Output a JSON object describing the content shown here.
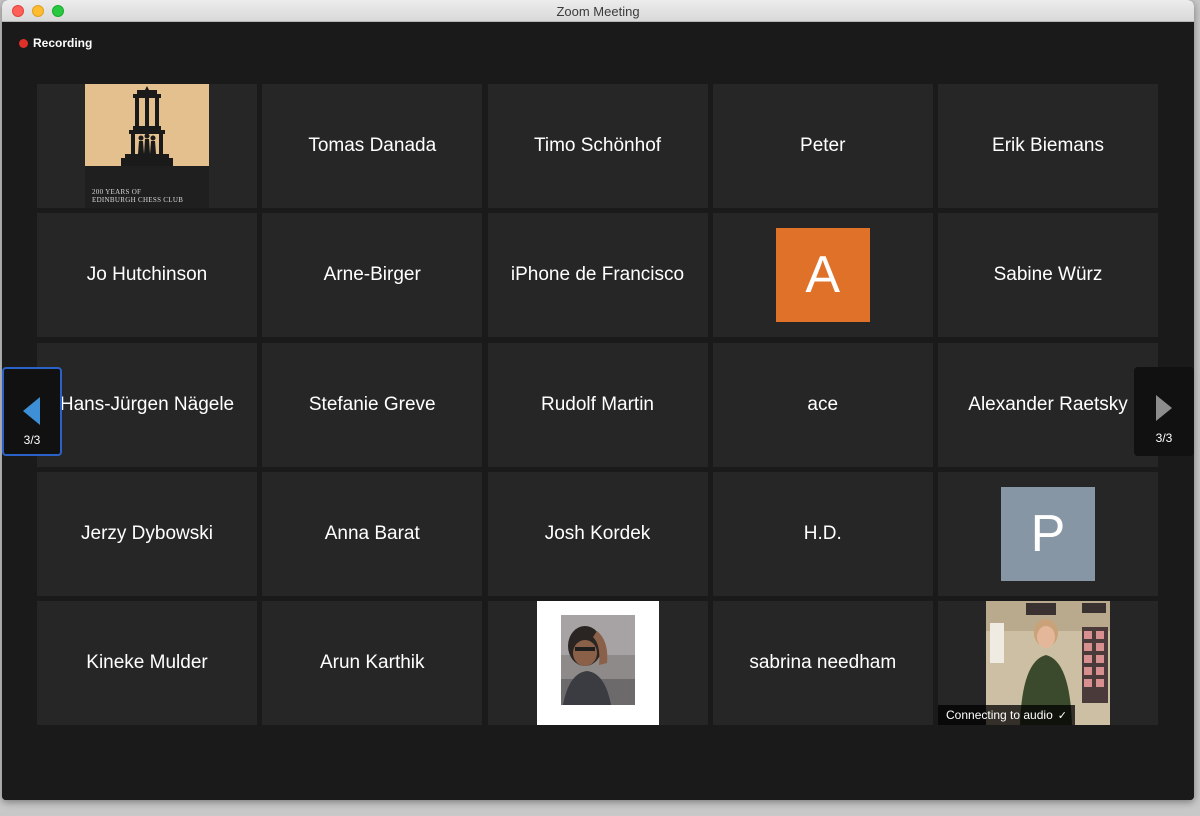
{
  "window": {
    "title": "Zoom Meeting"
  },
  "recording": {
    "label": "Recording"
  },
  "nav": {
    "left_count": "3/3",
    "right_count": "3/3"
  },
  "club_logo": {
    "caption_line1": "200 YEARS OF",
    "caption_line2": "EDINBURGH CHESS CLUB"
  },
  "avatars": {
    "a_letter": "A",
    "a_color": "#e07128",
    "p_letter": "P",
    "p_color": "#8696a5"
  },
  "participants": [
    {
      "type": "logo",
      "label": ""
    },
    {
      "type": "name",
      "label": "Tomas Danada"
    },
    {
      "type": "name",
      "label": "Timo Schönhof"
    },
    {
      "type": "name",
      "label": "Peter"
    },
    {
      "type": "name",
      "label": "Erik Biemans"
    },
    {
      "type": "name",
      "label": "Jo Hutchinson"
    },
    {
      "type": "name",
      "label": "Arne-Birger"
    },
    {
      "type": "name",
      "label": "iPhone de Francisco"
    },
    {
      "type": "avatar",
      "label": "A"
    },
    {
      "type": "name",
      "label": "Sabine Würz"
    },
    {
      "type": "name",
      "label": "Hans-Jürgen Nägele"
    },
    {
      "type": "name",
      "label": "Stefanie Greve"
    },
    {
      "type": "name",
      "label": "Rudolf Martin"
    },
    {
      "type": "name",
      "label": "ace"
    },
    {
      "type": "name",
      "label": "Alexander Raetsky"
    },
    {
      "type": "name",
      "label": "Jerzy Dybowski"
    },
    {
      "type": "name",
      "label": "Anna Barat"
    },
    {
      "type": "name",
      "label": "Josh Kordek"
    },
    {
      "type": "name",
      "label": "H.D."
    },
    {
      "type": "avatar",
      "label": "P"
    },
    {
      "type": "name",
      "label": "Kineke Mulder"
    },
    {
      "type": "name",
      "label": "Arun Karthik"
    },
    {
      "type": "photo",
      "label": ""
    },
    {
      "type": "name",
      "label": "sabrina needham"
    },
    {
      "type": "video",
      "label": ""
    }
  ],
  "audio_status": {
    "label": "Connecting to audio",
    "icon": "check-icon"
  }
}
